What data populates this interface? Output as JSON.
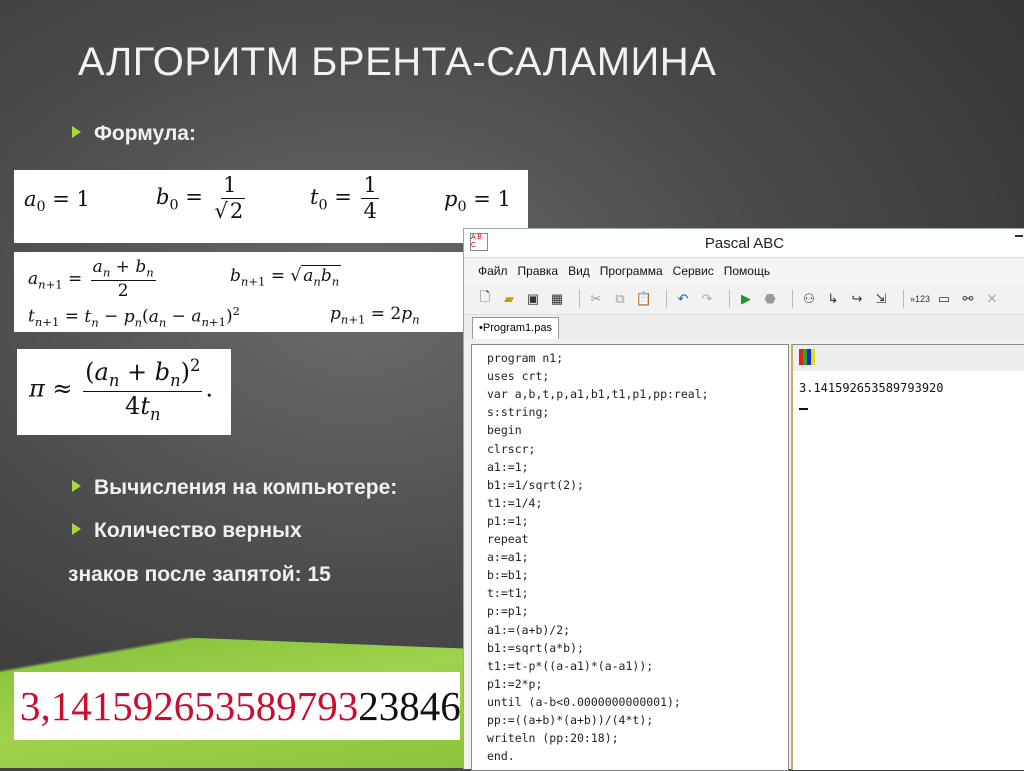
{
  "slide": {
    "title": "АЛГОРИТМ БРЕНТА-САЛАМИНА",
    "bullets": [
      "Формула:",
      "Вычисления на компьютере:",
      "Количество верных"
    ],
    "continuation": "знаков после запятой: 15",
    "pi_value": {
      "correct": "3,141592653589793",
      "rest": "23846"
    },
    "accent_color": "#a6d83a"
  },
  "app": {
    "window_title": "Pascal ABC",
    "menu": [
      "Файл",
      "Правка",
      "Вид",
      "Программа",
      "Сервис",
      "Помощь"
    ],
    "tab": "•Program1.pas",
    "code": [
      "program n1;",
      "uses crt;",
      "var a,b,t,p,a1,b1,t1,p1,pp:real;",
      "s:string;",
      "begin",
      "clrscr;",
      "a1:=1;",
      "b1:=1/sqrt(2);",
      "t1:=1/4;",
      "p1:=1;",
      "repeat",
      "a:=a1;",
      "b:=b1;",
      "t:=t1;",
      "p:=p1;",
      "a1:=(a+b)/2;",
      "b1:=sqrt(a*b);",
      "t1:=t-p*((a-a1)*(a-a1));",
      "p1:=2*p;",
      "until (a-b<0.0000000000001);",
      "pp:=((a+b)*(a+b))/(4*t);",
      "writeln (pp:20:18);",
      "end."
    ],
    "output": "3.141592653589793920"
  }
}
